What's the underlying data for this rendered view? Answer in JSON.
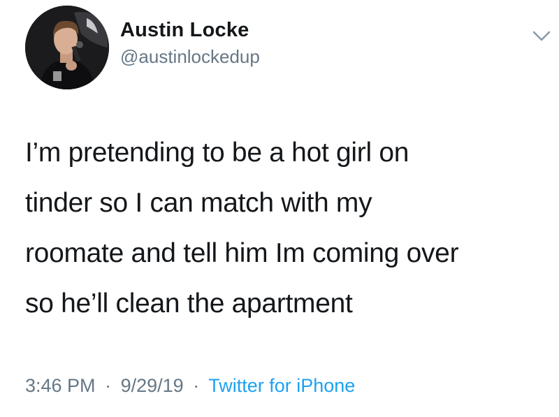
{
  "tweet": {
    "display_name": "Austin Locke",
    "handle": "@austinlockedup",
    "text_lines": [
      "I’m pretending to be a hot girl on",
      "tinder so I can match with my",
      "roomate and tell him Im coming over",
      "so he’ll clean the apartment"
    ],
    "time": "3:46 PM",
    "date": "9/29/19",
    "separator": "·",
    "source": "Twitter for iPhone"
  },
  "icons": {
    "avatar": "profile-photo",
    "menu": "chevron-down-icon"
  },
  "colors": {
    "text": "#14171a",
    "secondary": "#657786",
    "link": "#1da1f2",
    "background": "#ffffff"
  }
}
